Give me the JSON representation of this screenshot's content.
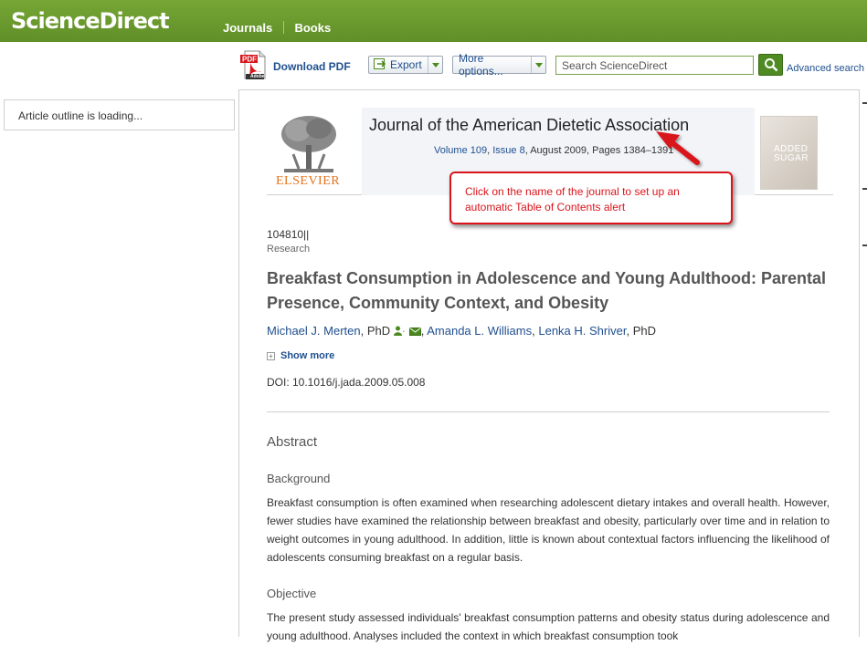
{
  "header": {
    "brand": "ScienceDirect",
    "nav": [
      "Journals",
      "Books"
    ]
  },
  "toolbar": {
    "pdf_label": "Download PDF",
    "pdf_icon_text": "Adobe",
    "export_label": "Export",
    "more_label": "More options...",
    "search_placeholder": "Search ScienceDirect",
    "advanced_search": "Advanced search"
  },
  "sidebar": {
    "outline_text": "Article outline is loading..."
  },
  "journal": {
    "publisher": "ELSEVIER",
    "title": "Journal of the American Dietetic Association",
    "volume": "Volume 109",
    "issue": "Issue 8",
    "date_pages": ", August 2009, Pages 1384–1391",
    "cover_text_1": "ADDED",
    "cover_text_2": "SUGAR"
  },
  "article": {
    "pii": "104810||",
    "category": "Research",
    "title": "Breakfast Consumption in Adolescence and Young Adulthood: Parental Presence, Community Context, and Obesity",
    "authors": [
      {
        "name": "Michael J. Merten",
        "suffix": ", PhD"
      },
      {
        "name": "Amanda L. Williams",
        "suffix": ","
      },
      {
        "name": "Lenka H. Shriver",
        "suffix": ", PhD"
      }
    ],
    "show_more": "Show more",
    "doi": "DOI: 10.1016/j.jada.2009.05.008",
    "abstract_heading": "Abstract",
    "background_heading": "Background",
    "background_text": "Breakfast consumption is often examined when researching adolescent dietary intakes and overall health. However, fewer studies have examined the relationship between breakfast and obesity, particularly over time and in relation to weight outcomes in young adulthood. In addition, little is known about contextual factors influencing the likelihood of adolescents consuming breakfast on a regular basis.",
    "objective_heading": "Objective",
    "objective_text": "The present study assessed individuals' breakfast consumption patterns and obesity status during adolescence and young adulthood. Analyses included the context in which breakfast consumption took"
  },
  "callout": {
    "text": "Click on the name of the journal to set up an automatic Table of Contents alert"
  },
  "colors": {
    "header_green": "#6b9a2e",
    "link_blue": "#1f4f8f",
    "callout_red": "#d9141b",
    "elsevier_orange": "#e5731b"
  }
}
